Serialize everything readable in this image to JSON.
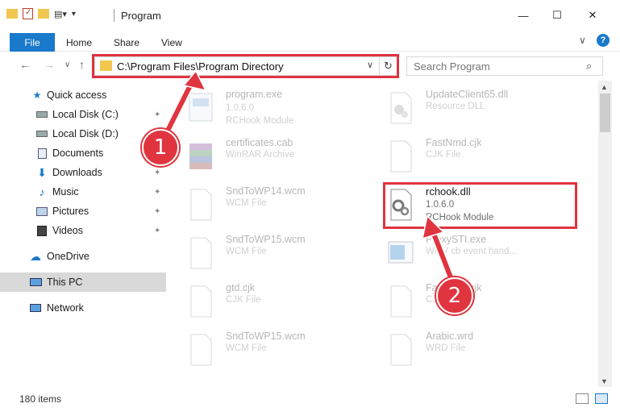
{
  "window": {
    "title": "Program",
    "minimize": "—",
    "maximize": "☐",
    "close": "✕"
  },
  "ribbon": {
    "tabs": [
      "File",
      "Home",
      "Share",
      "View"
    ],
    "help": "?",
    "collapse": "∨"
  },
  "address": {
    "back": "←",
    "forward": "→",
    "recent": "∨",
    "up": "↑",
    "path": "C:\\Program Files\\Program Directory",
    "dropdown": "∨",
    "refresh": "↻"
  },
  "search": {
    "placeholder": "Search Program",
    "icon": "⌕"
  },
  "sidebar": {
    "items": [
      {
        "label": "Quick access",
        "icon": "star-icon",
        "pinned": false
      },
      {
        "label": "Local Disk (C:)",
        "icon": "drive-icon",
        "pinned": true
      },
      {
        "label": "Local Disk (D:)",
        "icon": "drive-icon",
        "pinned": false
      },
      {
        "label": "Documents",
        "icon": "documents-icon",
        "pinned": false
      },
      {
        "label": "Downloads",
        "icon": "download-icon",
        "pinned": true
      },
      {
        "label": "Music",
        "icon": "music-icon",
        "pinned": true
      },
      {
        "label": "Pictures",
        "icon": "pictures-icon",
        "pinned": true
      },
      {
        "label": "Videos",
        "icon": "videos-icon",
        "pinned": true
      },
      {
        "label": "OneDrive",
        "icon": "cloud-icon",
        "pinned": false
      },
      {
        "label": "This PC",
        "icon": "computer-icon",
        "pinned": false,
        "selected": true
      },
      {
        "label": "Network",
        "icon": "network-icon",
        "pinned": false
      }
    ],
    "pin_glyph": "📌"
  },
  "files": {
    "left": [
      {
        "name": "program.exe",
        "version": "1.0.6.0",
        "type": "RCHook Module",
        "icon": "exe-icon"
      },
      {
        "name": "certificates.cab",
        "version": "",
        "type": "WinRAR Archive",
        "icon": "winrar-icon"
      },
      {
        "name": "SndToWP14.wcm",
        "version": "",
        "type": "WCM File",
        "icon": "file-icon"
      },
      {
        "name": "SndToWP15.wcm",
        "version": "",
        "type": "WCM File",
        "icon": "file-icon"
      },
      {
        "name": "gtd.cjk",
        "version": "",
        "type": "CJK File",
        "icon": "file-icon"
      },
      {
        "name": "SndToWP15.wcm",
        "version": "",
        "type": "WCM File",
        "icon": "file-icon"
      }
    ],
    "right": [
      {
        "name": "UpdateClient65.dll",
        "version": "",
        "type": "Resource DLL",
        "icon": "dll-icon"
      },
      {
        "name": "FastNmd.cjk",
        "version": "",
        "type": "CJK File",
        "icon": "file-icon"
      },
      {
        "name": "rchook.dll",
        "version": "1.0.6.0",
        "type": "RCHook Module",
        "icon": "dll-icon",
        "highlight": true
      },
      {
        "name": "ProxySTI.exe",
        "version": "",
        "type": "WMV cb event hand...",
        "icon": "app-icon"
      },
      {
        "name": "FastNmd.cjk",
        "version": "",
        "type": "CJK File",
        "icon": "file-icon"
      },
      {
        "name": "Arabic.wrd",
        "version": "",
        "type": "WRD File",
        "icon": "file-icon"
      }
    ]
  },
  "status": {
    "count": "180 items"
  },
  "callouts": {
    "one": "1",
    "two": "2"
  },
  "colors": {
    "accent": "#1979ca",
    "highlight_red": "#e0343f",
    "selected_bg": "#d9d9d9"
  }
}
